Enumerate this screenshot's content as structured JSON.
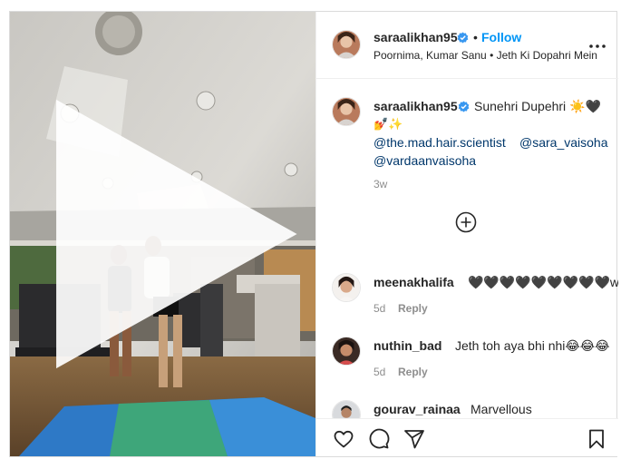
{
  "post": {
    "author": {
      "username": "saraalikhan95",
      "verified": true,
      "follow_label": "Follow",
      "separator": "•",
      "audio": "Poornima, Kumar Sanu • Jeth Ki Dopahri Mein"
    },
    "video": {
      "play_icon": "play-icon"
    },
    "caption": {
      "username": "saraalikhan95",
      "text": "Sunehri Dupehri ☀️🖤",
      "emoji_line": "💅✨",
      "mention_1": "@the.mad.hair.scientist",
      "mention_2": "@sara_vaisoha",
      "mention_3": "@vardaanvaisoha",
      "time": "3w"
    },
    "load_more_icon": "plus-circle-icon",
    "comments": [
      {
        "username": "meenakhalifa",
        "text": "🖤🖤🖤🖤🖤🖤🖤🖤🖤woh",
        "time": "5d",
        "reply_label": "Reply"
      },
      {
        "username": "nuthin_bad",
        "text": "Jeth toh aya bhi nhi😂😂😂",
        "time": "5d",
        "reply_label": "Reply"
      },
      {
        "username": "gourav_rainaa",
        "text": "Marvellous"
      }
    ],
    "actions": [
      "heart-icon",
      "comment-icon",
      "share-icon",
      "bookmark-icon"
    ],
    "colors": {
      "link_blue": "#0095f6",
      "mention_blue": "#00376b",
      "verified_blue": "#3897f0",
      "muted": "#8e8e8e"
    }
  }
}
